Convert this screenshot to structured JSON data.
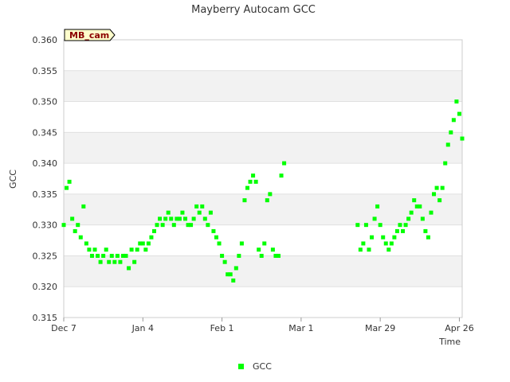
{
  "chart_data": {
    "type": "scatter",
    "title": "Mayberry Autocam GCC",
    "xlabel": "Time",
    "ylabel": "GCC",
    "site_tag": "MB_cam",
    "x_ticks": [
      "Dec 7",
      "Jan 4",
      "Feb 1",
      "Mar 1",
      "Mar 29",
      "Apr 26"
    ],
    "xlim": [
      "2019-12-07",
      "2020-04-26"
    ],
    "ylim": [
      0.315,
      0.36
    ],
    "y_ticks": [
      "0.315",
      "0.320",
      "0.325",
      "0.330",
      "0.335",
      "0.340",
      "0.345",
      "0.350",
      "0.355",
      "0.360"
    ],
    "grid": "alternating horizontal bands",
    "legend": "bottom-center",
    "series": [
      {
        "name": "GCC",
        "color": "#00ff00",
        "marker": "square",
        "points": [
          [
            "2019-12-07",
            0.33
          ],
          [
            "2019-12-08",
            0.336
          ],
          [
            "2019-12-09",
            0.337
          ],
          [
            "2019-12-10",
            0.331
          ],
          [
            "2019-12-11",
            0.329
          ],
          [
            "2019-12-12",
            0.33
          ],
          [
            "2019-12-13",
            0.328
          ],
          [
            "2019-12-14",
            0.333
          ],
          [
            "2019-12-15",
            0.327
          ],
          [
            "2019-12-16",
            0.326
          ],
          [
            "2019-12-17",
            0.325
          ],
          [
            "2019-12-18",
            0.326
          ],
          [
            "2019-12-19",
            0.325
          ],
          [
            "2019-12-20",
            0.324
          ],
          [
            "2019-12-21",
            0.325
          ],
          [
            "2019-12-22",
            0.326
          ],
          [
            "2019-12-23",
            0.324
          ],
          [
            "2019-12-24",
            0.325
          ],
          [
            "2019-12-25",
            0.324
          ],
          [
            "2019-12-26",
            0.325
          ],
          [
            "2019-12-27",
            0.324
          ],
          [
            "2019-12-28",
            0.325
          ],
          [
            "2019-12-29",
            0.325
          ],
          [
            "2019-12-30",
            0.323
          ],
          [
            "2019-12-31",
            0.326
          ],
          [
            "2020-01-01",
            0.324
          ],
          [
            "2020-01-02",
            0.326
          ],
          [
            "2020-01-03",
            0.327
          ],
          [
            "2020-01-04",
            0.327
          ],
          [
            "2020-01-05",
            0.326
          ],
          [
            "2020-01-06",
            0.327
          ],
          [
            "2020-01-07",
            0.328
          ],
          [
            "2020-01-08",
            0.329
          ],
          [
            "2020-01-09",
            0.33
          ],
          [
            "2020-01-10",
            0.331
          ],
          [
            "2020-01-11",
            0.33
          ],
          [
            "2020-01-12",
            0.331
          ],
          [
            "2020-01-13",
            0.332
          ],
          [
            "2020-01-14",
            0.331
          ],
          [
            "2020-01-15",
            0.33
          ],
          [
            "2020-01-16",
            0.331
          ],
          [
            "2020-01-17",
            0.331
          ],
          [
            "2020-01-18",
            0.332
          ],
          [
            "2020-01-19",
            0.331
          ],
          [
            "2020-01-20",
            0.33
          ],
          [
            "2020-01-21",
            0.33
          ],
          [
            "2020-01-22",
            0.331
          ],
          [
            "2020-01-23",
            0.333
          ],
          [
            "2020-01-24",
            0.332
          ],
          [
            "2020-01-25",
            0.333
          ],
          [
            "2020-01-26",
            0.331
          ],
          [
            "2020-01-27",
            0.33
          ],
          [
            "2020-01-28",
            0.332
          ],
          [
            "2020-01-29",
            0.329
          ],
          [
            "2020-01-30",
            0.328
          ],
          [
            "2020-01-31",
            0.327
          ],
          [
            "2020-02-01",
            0.325
          ],
          [
            "2020-02-02",
            0.324
          ],
          [
            "2020-02-03",
            0.322
          ],
          [
            "2020-02-04",
            0.322
          ],
          [
            "2020-02-05",
            0.321
          ],
          [
            "2020-02-06",
            0.323
          ],
          [
            "2020-02-07",
            0.325
          ],
          [
            "2020-02-08",
            0.327
          ],
          [
            "2020-02-09",
            0.334
          ],
          [
            "2020-02-10",
            0.336
          ],
          [
            "2020-02-11",
            0.337
          ],
          [
            "2020-02-12",
            0.338
          ],
          [
            "2020-02-13",
            0.337
          ],
          [
            "2020-02-14",
            0.326
          ],
          [
            "2020-02-15",
            0.325
          ],
          [
            "2020-02-16",
            0.327
          ],
          [
            "2020-02-17",
            0.334
          ],
          [
            "2020-02-18",
            0.335
          ],
          [
            "2020-02-19",
            0.326
          ],
          [
            "2020-02-20",
            0.325
          ],
          [
            "2020-02-21",
            0.325
          ],
          [
            "2020-02-22",
            0.338
          ],
          [
            "2020-02-23",
            0.34
          ],
          [
            "2020-03-20",
            0.33
          ],
          [
            "2020-03-21",
            0.326
          ],
          [
            "2020-03-22",
            0.327
          ],
          [
            "2020-03-23",
            0.33
          ],
          [
            "2020-03-24",
            0.326
          ],
          [
            "2020-03-25",
            0.328
          ],
          [
            "2020-03-26",
            0.331
          ],
          [
            "2020-03-27",
            0.333
          ],
          [
            "2020-03-28",
            0.33
          ],
          [
            "2020-03-29",
            0.328
          ],
          [
            "2020-03-30",
            0.327
          ],
          [
            "2020-03-31",
            0.326
          ],
          [
            "2020-04-01",
            0.327
          ],
          [
            "2020-04-02",
            0.328
          ],
          [
            "2020-04-03",
            0.329
          ],
          [
            "2020-04-04",
            0.33
          ],
          [
            "2020-04-05",
            0.329
          ],
          [
            "2020-04-06",
            0.33
          ],
          [
            "2020-04-07",
            0.331
          ],
          [
            "2020-04-08",
            0.332
          ],
          [
            "2020-04-09",
            0.334
          ],
          [
            "2020-04-10",
            0.333
          ],
          [
            "2020-04-11",
            0.333
          ],
          [
            "2020-04-12",
            0.331
          ],
          [
            "2020-04-13",
            0.329
          ],
          [
            "2020-04-14",
            0.328
          ],
          [
            "2020-04-15",
            0.332
          ],
          [
            "2020-04-16",
            0.335
          ],
          [
            "2020-04-17",
            0.336
          ],
          [
            "2020-04-18",
            0.334
          ],
          [
            "2020-04-19",
            0.336
          ],
          [
            "2020-04-20",
            0.34
          ],
          [
            "2020-04-21",
            0.343
          ],
          [
            "2020-04-22",
            0.345
          ],
          [
            "2020-04-23",
            0.347
          ],
          [
            "2020-04-24",
            0.35
          ],
          [
            "2020-04-25",
            0.348
          ],
          [
            "2020-04-26",
            0.344
          ]
        ]
      }
    ]
  }
}
